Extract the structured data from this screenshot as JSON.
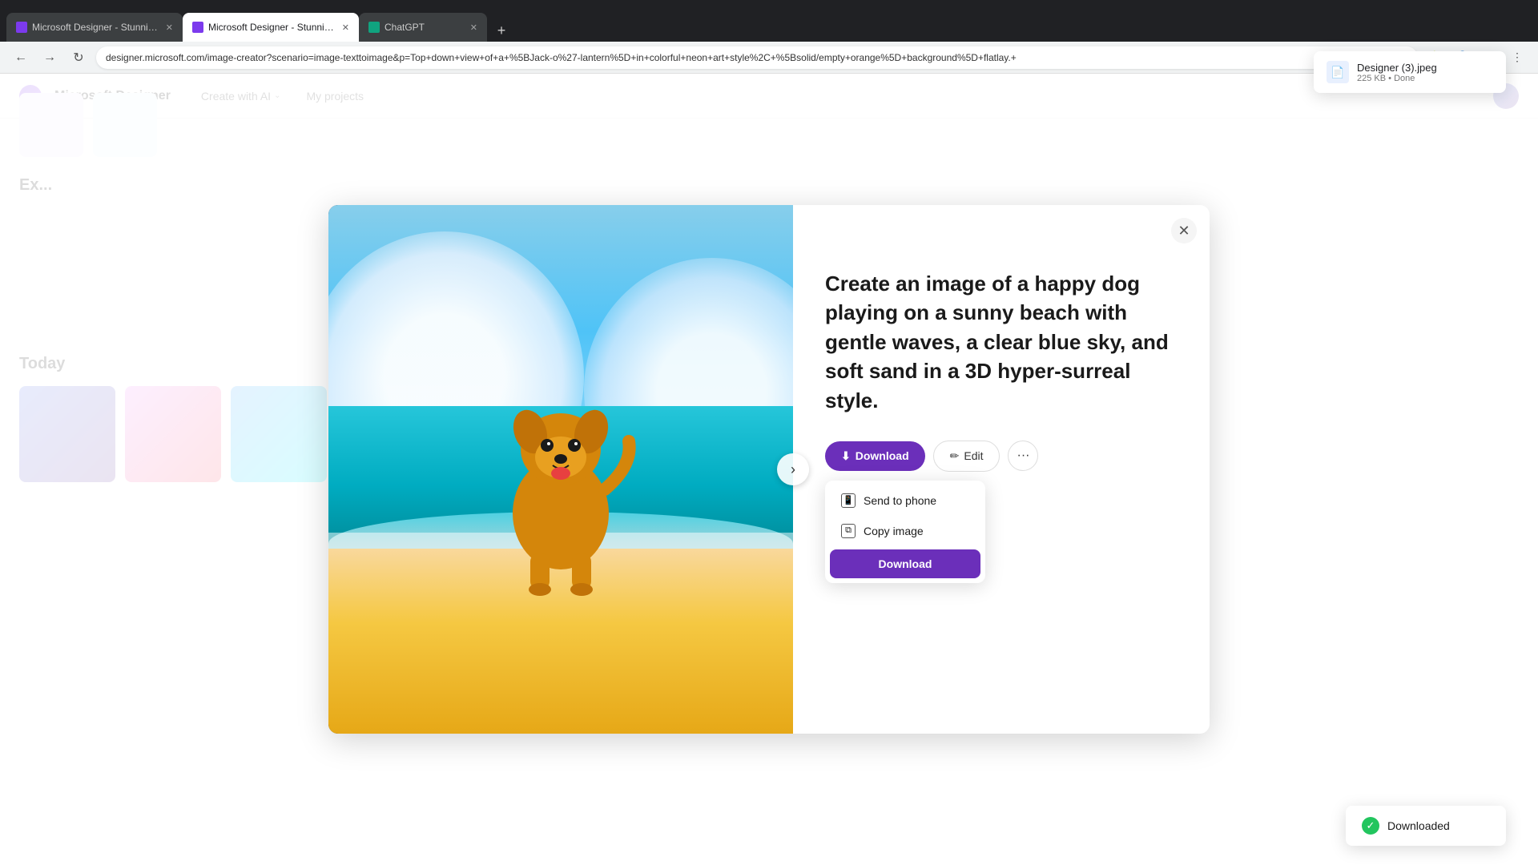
{
  "browser": {
    "tabs": [
      {
        "id": "tab1",
        "label": "Microsoft Designer - Stunning...",
        "favicon_color": "#7c3aed",
        "active": false
      },
      {
        "id": "tab2",
        "label": "Microsoft Designer - Stunning...",
        "favicon_color": "#7c3aed",
        "active": true
      },
      {
        "id": "tab3",
        "label": "ChatGPT",
        "favicon_color": "#10a37f",
        "active": false
      }
    ],
    "address": "designer.microsoft.com/image-creator?scenario=image-texttoimage&p=Top+down+view+of+a+%5BJack-o%27-lantern%5D+in+colorful+neon+art+style%2C+%5Bsolid/empty+orange%5D+background%5D+flatlay.+",
    "new_tab_label": "+"
  },
  "download_notification": {
    "filename": "Designer (3).jpeg",
    "size": "225 KB",
    "status": "Done"
  },
  "app": {
    "logo_label": "Microsoft Designer",
    "nav_items": [
      {
        "label": "Create with AI",
        "has_chevron": true
      },
      {
        "label": "My projects",
        "has_chevron": false
      }
    ]
  },
  "background": {
    "today_label": "Today",
    "explore_label": "Ex..."
  },
  "modal": {
    "prompt_text": "Create an image of a happy dog playing on a sunny beach with gentle waves, a clear blue sky, and soft sand in a 3D hyper-surreal style.",
    "buttons": {
      "download_label": "Download",
      "edit_label": "Edit",
      "more_label": "···"
    },
    "dropdown": {
      "send_to_phone_label": "Send to phone",
      "copy_image_label": "Copy image",
      "download_label": "Download"
    }
  },
  "toast": {
    "label": "Downloaded"
  },
  "icons": {
    "download_icon": "⬇",
    "edit_icon": "✏",
    "close_icon": "✕",
    "phone_icon": "📱",
    "copy_icon": "⧉",
    "check_icon": "✓",
    "chevron_right": "›",
    "chevron_down": "⌄",
    "back_icon": "←",
    "forward_icon": "→",
    "refresh_icon": "↻",
    "more_icon": "⋯"
  }
}
